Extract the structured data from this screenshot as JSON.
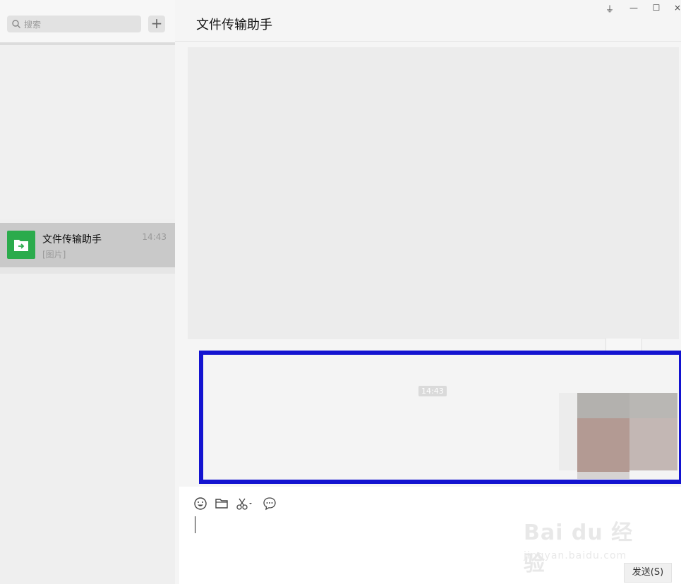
{
  "search": {
    "placeholder": "搜索",
    "add_label": "+"
  },
  "chat_list": [
    {
      "name": "文件传输助手",
      "time": "14:43",
      "preview": "[图片]"
    }
  ],
  "header": {
    "title": "文件传输助手"
  },
  "window_controls": {
    "pin": "⏚",
    "minimize": "—",
    "maximize": "☐",
    "close": "×"
  },
  "message": {
    "timestamp": "14:43"
  },
  "input": {
    "send_label": "发送(S)"
  },
  "watermark": {
    "line1": "Bai du 经验",
    "line2": "jingyan.baidu.com"
  },
  "colors": {
    "accent": "#2bab4c",
    "highlight_frame": "#1313d0"
  },
  "toolbar_icons": [
    "emoji-icon",
    "folder-icon",
    "scissors-icon",
    "chat-bubble-icon"
  ]
}
